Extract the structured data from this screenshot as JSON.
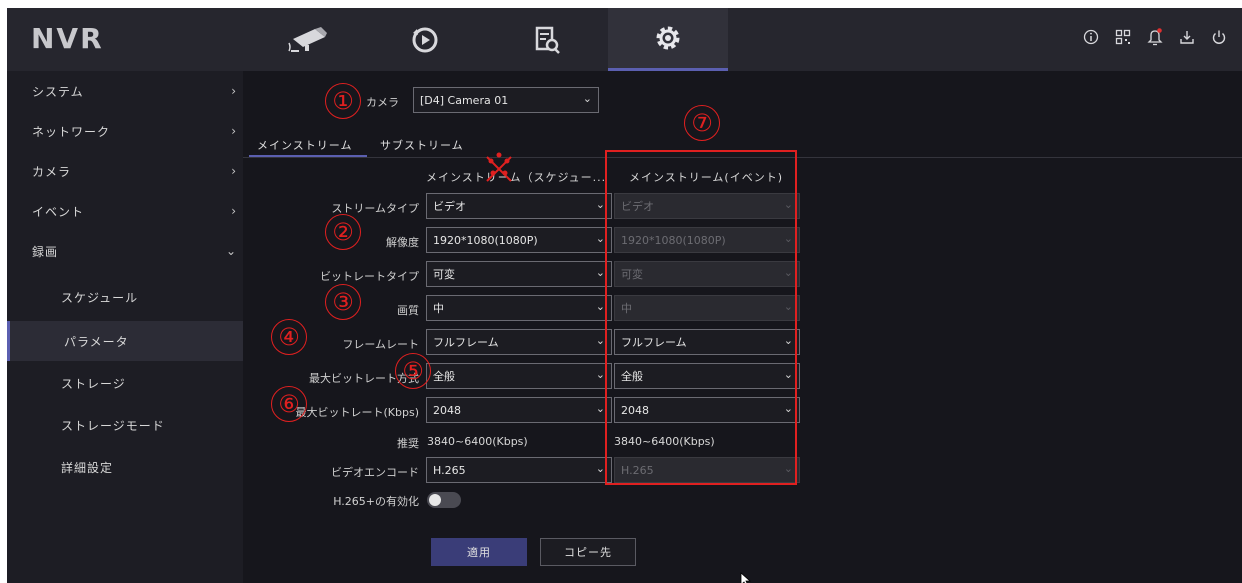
{
  "topbar": {
    "logo": "NVR",
    "nav": [
      "camera-icon",
      "playback-icon",
      "search-icon",
      "settings-icon"
    ],
    "right_icons": [
      "info-icon",
      "qr-icon",
      "bell-icon",
      "download-icon",
      "power-icon"
    ]
  },
  "sidebar": {
    "items": [
      {
        "label": "システム"
      },
      {
        "label": "ネットワーク"
      },
      {
        "label": "カメラ"
      },
      {
        "label": "イベント"
      },
      {
        "label": "録画"
      },
      {
        "label": "スケジュール"
      },
      {
        "label": "パラメータ"
      },
      {
        "label": "ストレージ"
      },
      {
        "label": "ストレージモード"
      },
      {
        "label": "詳細設定"
      }
    ]
  },
  "camera": {
    "label": "カメラ",
    "value": "[D4] Camera 01"
  },
  "tabs": [
    "メインストリーム",
    "サブストリーム"
  ],
  "columns": {
    "schedule": "メインストリーム（スケジュー...",
    "event": "メインストリーム(イベント)"
  },
  "form": {
    "stream_type": {
      "label": "ストリームタイプ",
      "main": "ビデオ",
      "event": "ビデオ"
    },
    "resolution": {
      "label": "解像度",
      "main": "1920*1080(1080P)",
      "event": "1920*1080(1080P)"
    },
    "bitrate_type": {
      "label": "ビットレートタイプ",
      "main": "可変",
      "event": "可変"
    },
    "quality": {
      "label": "画質",
      "main": "中",
      "event": "中"
    },
    "frame_rate": {
      "label": "フレームレート",
      "main": "フルフレーム",
      "event": "フルフレーム"
    },
    "max_bitrate_mode": {
      "label": "最大ビットレート方式",
      "main": "全般",
      "event": "全般"
    },
    "max_bitrate": {
      "label": "最大ビットレート(Kbps)",
      "main": "2048",
      "event": "2048"
    },
    "recommended": {
      "label": "推奨",
      "main": "3840~6400(Kbps)",
      "event": "3840~6400(Kbps)"
    },
    "video_encode": {
      "label": "ビデオエンコード",
      "main": "H.265",
      "event": "H.265"
    },
    "h265plus": {
      "label": "H.265+の有効化"
    }
  },
  "buttons": {
    "apply": "適用",
    "copy": "コピー先"
  },
  "annotations": {
    "n1": "①",
    "n2": "②",
    "n3": "③",
    "n4": "④",
    "n5": "⑤",
    "n6": "⑥",
    "n7": "⑦"
  },
  "colors": {
    "accent": "#5b5fb0",
    "annotation": "#e02020"
  }
}
